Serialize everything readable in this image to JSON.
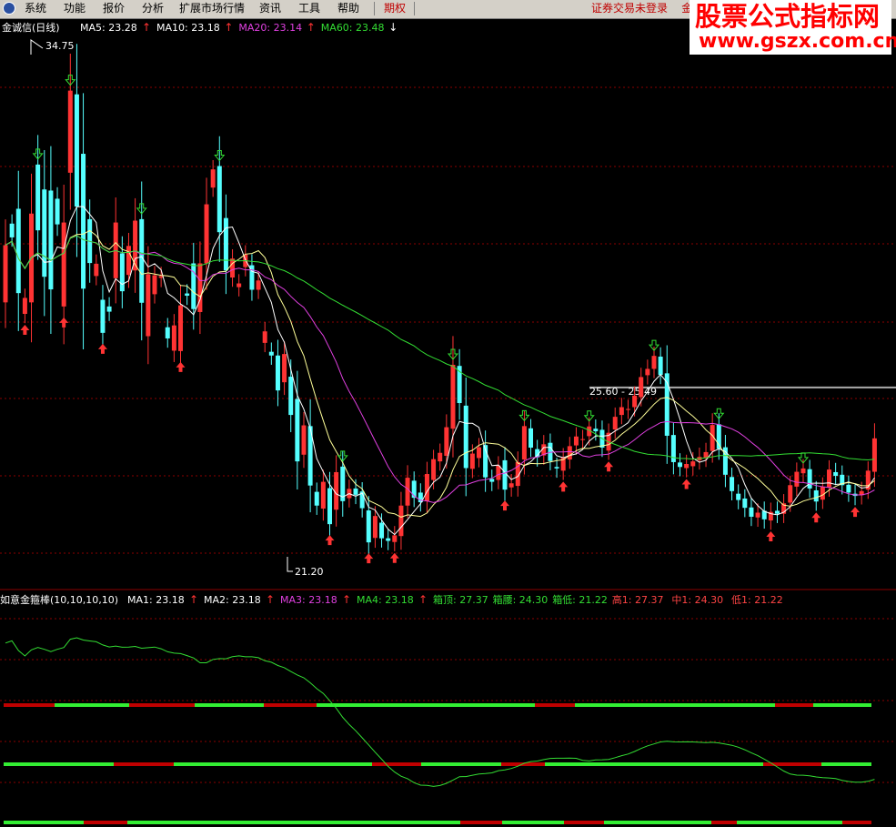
{
  "menu": {
    "items": [
      "系统",
      "功能",
      "报价",
      "分析",
      "扩展市场行情",
      "资讯",
      "工具",
      "帮助",
      "期权"
    ],
    "status": "证券交易未登录",
    "right_text": "金"
  },
  "watermark": {
    "line1": "股票公式指标网",
    "line2": "www.gszx.com.cn"
  },
  "top_panel": {
    "title": "金诚信(日线)",
    "legend": [
      {
        "label": "MA5: 23.28",
        "color": "#ffffff",
        "arrow": "↑"
      },
      {
        "label": "MA10: 23.18",
        "color": "#ffffff",
        "arrow": "↑"
      },
      {
        "label": "MA20: 23.14",
        "color": "#e040e0",
        "arrow": "↑"
      },
      {
        "label": "MA60: 23.48",
        "color": "#33dd33",
        "arrow": "↓"
      }
    ],
    "annotations": {
      "high": "34.75",
      "low": "21.20",
      "box": "25.60 - 25.49"
    }
  },
  "bottom_panel": {
    "title": "如意金箍棒(10,10,10,10)",
    "legend": [
      {
        "label": "MA1: 23.18",
        "color": "#ffffff",
        "arrow": "↑"
      },
      {
        "label": "MA2: 23.18",
        "color": "#ffffff",
        "arrow": "↑"
      },
      {
        "label": "MA3: 23.18",
        "color": "#e040e0",
        "arrow": "↑"
      },
      {
        "label": "MA4: 23.18",
        "color": "#33dd33",
        "arrow": "↑"
      },
      {
        "label": "箱顶: 27.37",
        "color": "#33dd33",
        "arrow": ""
      },
      {
        "label": "箱腰: 24.30",
        "color": "#33dd33",
        "arrow": ""
      },
      {
        "label": "箱低: 21.22",
        "color": "#33dd33",
        "arrow": ""
      },
      {
        "label": "高1: 27.37",
        "color": "#ff4444",
        "arrow": ""
      },
      {
        "label": "中1: 24.30",
        "color": "#ff4444",
        "arrow": ""
      },
      {
        "label": "低1: 21.22",
        "color": "#ff4444",
        "arrow": ""
      }
    ]
  },
  "colors": {
    "up": "#ff3333",
    "down": "#55ffff",
    "ma5": "#ffffff",
    "ma10": "#ffff99",
    "ma20": "#e040e0",
    "ma60": "#33dd33",
    "grid": "#8b0000",
    "box": "#aaaaaa"
  },
  "chart_data": {
    "type": "candlestick",
    "price_range": [
      20.6,
      35.0
    ],
    "box_level": 25.55,
    "candles": [
      [
        27.84,
        29.38
      ],
      [
        29.96,
        29.59
      ],
      [
        30.36,
        28.09
      ],
      [
        27.53,
        27.96
      ],
      [
        27.84,
        30.23
      ],
      [
        31.55,
        29.78
      ],
      [
        30.88,
        28.53
      ],
      [
        30.85,
        28.19
      ],
      [
        30.63,
        29.94
      ],
      [
        27.73,
        29.99
      ],
      [
        31.33,
        33.54
      ],
      [
        33.44,
        30.42
      ],
      [
        31.84,
        28.21
      ],
      [
        30.08,
        28.9
      ],
      [
        28.55,
        28.88
      ],
      [
        27.91,
        27.02
      ],
      [
        27.73,
        27.59
      ],
      [
        28.49,
        29.99
      ],
      [
        29.16,
        28.14
      ],
      [
        28.58,
        29.36
      ],
      [
        28.7,
        30.04
      ],
      [
        30.08,
        27.83
      ],
      [
        26.93,
        28.6
      ],
      [
        28.06,
        28.57
      ],
      [
        28.5,
        28.55
      ],
      [
        27.17,
        26.87
      ],
      [
        26.54,
        27.22
      ],
      [
        26.53,
        27.76
      ],
      [
        28.08,
        28.02
      ],
      [
        28.89,
        27.66
      ],
      [
        27.58,
        28.89
      ],
      [
        28.89,
        30.48
      ],
      [
        30.93,
        31.42
      ],
      [
        31.51,
        29.73
      ],
      [
        30.11,
        28.7
      ],
      [
        28.51,
        29.02
      ],
      [
        28.25,
        28.35
      ],
      [
        28.79,
        29.13
      ],
      [
        28.84,
        28.18
      ],
      [
        28.18,
        28.43
      ],
      [
        26.75,
        27.06
      ],
      [
        26.51,
        26.41
      ],
      [
        26.41,
        25.47
      ],
      [
        25.69,
        26.45
      ],
      [
        25.84,
        24.81
      ],
      [
        25.24,
        23.56
      ],
      [
        23.74,
        24.53
      ],
      [
        24.51,
        22.91
      ],
      [
        22.74,
        22.37
      ],
      [
        22.29,
        23.01
      ],
      [
        22.84,
        21.87
      ],
      [
        22.26,
        23.27
      ],
      [
        23.42,
        22.49
      ],
      [
        22.57,
        22.82
      ],
      [
        22.83,
        22.66
      ],
      [
        22.75,
        22.3
      ],
      [
        22.24,
        21.38
      ],
      [
        21.5,
        22.09
      ],
      [
        21.91,
        21.49
      ],
      [
        21.49,
        21.42
      ],
      [
        21.39,
        21.57
      ],
      [
        21.55,
        22.37
      ],
      [
        22.37,
        23.12
      ],
      [
        23.04,
        22.58
      ],
      [
        22.72,
        22.46
      ],
      [
        22.49,
        23.22
      ],
      [
        23.06,
        23.62
      ],
      [
        23.56,
        23.79
      ],
      [
        23.71,
        24.48
      ],
      [
        24.44,
        26.16
      ],
      [
        26.13,
        25.13
      ],
      [
        25.06,
        23.38
      ],
      [
        23.36,
        23.77
      ],
      [
        23.65,
        23.94
      ],
      [
        24.0,
        23.13
      ],
      [
        23.09,
        23.01
      ],
      [
        23.06,
        23.45
      ],
      [
        23.59,
        22.8
      ],
      [
        22.86,
        22.97
      ],
      [
        22.9,
        23.54
      ],
      [
        23.61,
        24.51
      ],
      [
        24.45,
        23.93
      ],
      [
        23.89,
        23.67
      ],
      [
        23.72,
        24.02
      ],
      [
        24.06,
        23.57
      ],
      [
        23.41,
        23.37
      ],
      [
        23.31,
        23.67
      ],
      [
        23.61,
        23.97
      ],
      [
        23.99,
        24.23
      ],
      [
        24.14,
        24.16
      ],
      [
        24.24,
        24.5
      ],
      [
        24.44,
        24.37
      ],
      [
        24.41,
        23.93
      ],
      [
        23.85,
        24.33
      ],
      [
        24.42,
        24.76
      ],
      [
        24.81,
        25.02
      ],
      [
        24.95,
        24.97
      ],
      [
        25.02,
        25.33
      ],
      [
        25.29,
        25.83
      ],
      [
        25.88,
        26.05
      ],
      [
        26.05,
        26.4
      ],
      [
        26.38,
        25.89
      ],
      [
        25.93,
        24.25
      ],
      [
        24.27,
        23.54
      ],
      [
        23.53,
        23.41
      ],
      [
        23.38,
        23.49
      ],
      [
        23.43,
        23.56
      ],
      [
        23.59,
        23.68
      ],
      [
        23.66,
        23.81
      ],
      [
        23.84,
        24.54
      ],
      [
        24.56,
        23.9
      ],
      [
        23.94,
        23.2
      ],
      [
        23.14,
        22.76
      ],
      [
        22.69,
        22.52
      ],
      [
        22.56,
        22.31
      ],
      [
        22.32,
        22.07
      ],
      [
        22.05,
        22.18
      ],
      [
        22.23,
        22.0
      ],
      [
        21.97,
        22.2
      ],
      [
        22.23,
        22.15
      ],
      [
        22.15,
        22.43
      ],
      [
        22.45,
        22.92
      ],
      [
        22.88,
        23.28
      ],
      [
        23.24,
        23.37
      ],
      [
        23.35,
        22.83
      ],
      [
        22.78,
        22.48
      ],
      [
        22.53,
        22.88
      ],
      [
        22.86,
        23.34
      ],
      [
        23.27,
        23.17
      ],
      [
        23.2,
        22.92
      ],
      [
        22.93,
        22.72
      ],
      [
        22.69,
        22.63
      ],
      [
        22.65,
        22.76
      ],
      [
        22.8,
        23.31
      ],
      [
        23.28,
        24.18
      ]
    ]
  }
}
